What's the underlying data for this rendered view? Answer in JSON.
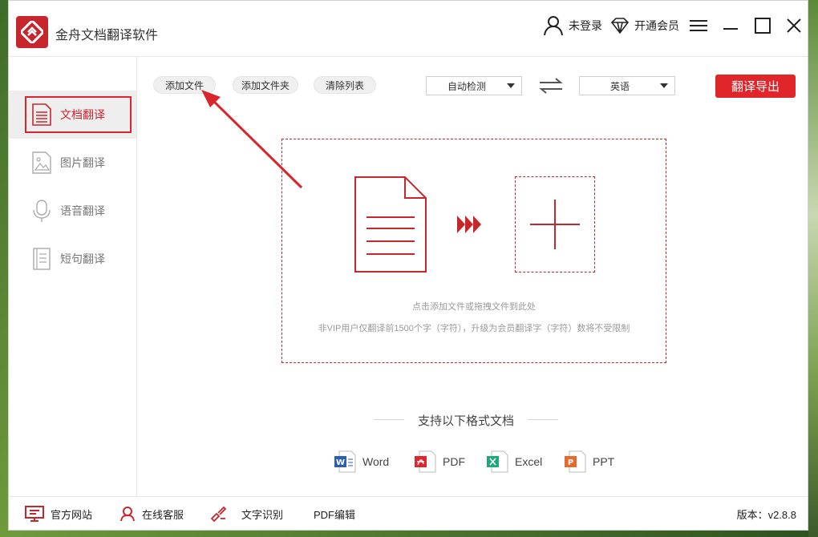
{
  "app": {
    "title": "金舟文档翻译软件",
    "brand_color": "#c8262d"
  },
  "header": {
    "login_label": "未登录",
    "vip_label": "开通会员"
  },
  "sidebar": {
    "items": [
      {
        "label": "文档翻译",
        "icon": "document-icon",
        "active": true
      },
      {
        "label": "图片翻译",
        "icon": "image-icon",
        "active": false
      },
      {
        "label": "语音翻译",
        "icon": "microphone-icon",
        "active": false
      },
      {
        "label": "短句翻译",
        "icon": "notes-icon",
        "active": false
      }
    ]
  },
  "toolbar": {
    "add_file": "添加文件",
    "add_folder": "添加文件夹",
    "clear_list": "清除列表",
    "source_lang": "自动检测",
    "target_lang": "英语",
    "export": "翻译导出"
  },
  "dropzone": {
    "hint": "点击添加文件或拖拽文件到此处",
    "limit_note": "非VIP用户仅翻译前1500个字（字符），升级为会员翻译字（字符）数将不受限制"
  },
  "formats": {
    "title": "支持以下格式文档",
    "items": [
      {
        "label": "Word",
        "icon": "word-icon",
        "color": "#2b5fb4"
      },
      {
        "label": "PDF",
        "icon": "pdf-icon",
        "color": "#e0252b"
      },
      {
        "label": "Excel",
        "icon": "excel-icon",
        "color": "#1fa87a"
      },
      {
        "label": "PPT",
        "icon": "ppt-icon",
        "color": "#e8692c"
      }
    ]
  },
  "footer": {
    "website": "官方网站",
    "support": "在线客服",
    "ocr": "文字识别",
    "pdf_edit": "PDF编辑",
    "version": "版本：v2.8.8"
  }
}
